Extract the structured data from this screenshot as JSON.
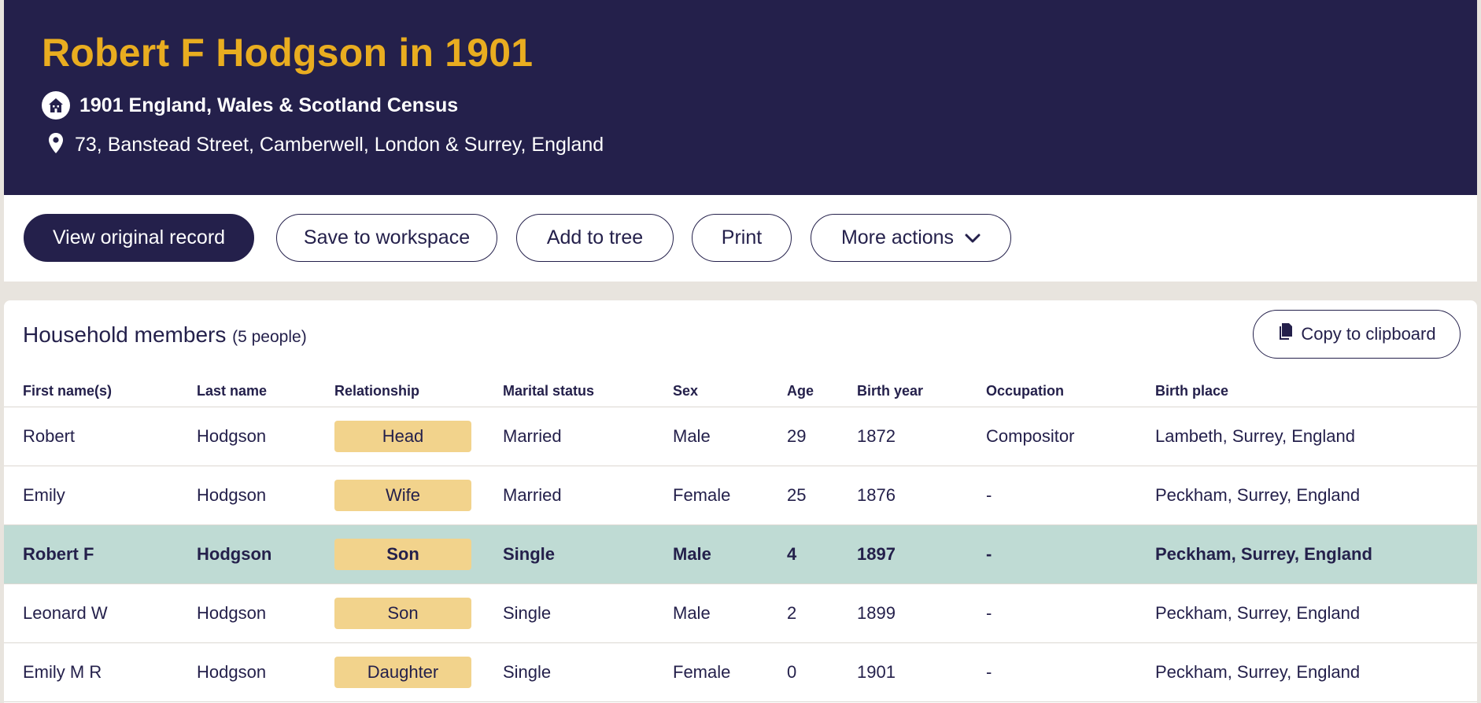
{
  "header": {
    "title": "Robert F Hodgson in 1901",
    "collection": "1901 England, Wales & Scotland Census",
    "address": "73, Banstead Street, Camberwell, London & Surrey, England"
  },
  "actions": {
    "view_original": "View original record",
    "save_workspace": "Save to workspace",
    "add_to_tree": "Add to tree",
    "print": "Print",
    "more_actions": "More actions"
  },
  "household": {
    "title": "Household members",
    "count": "(5 people)",
    "copy_label": "Copy to clipboard",
    "columns": [
      "First name(s)",
      "Last name",
      "Relationship",
      "Marital status",
      "Sex",
      "Age",
      "Birth year",
      "Occupation",
      "Birth place"
    ],
    "rows": [
      [
        "Robert",
        "Hodgson",
        "Head",
        "Married",
        "Male",
        "29",
        "1872",
        "Compositor",
        "Lambeth, Surrey, England"
      ],
      [
        "Emily",
        "Hodgson",
        "Wife",
        "Married",
        "Female",
        "25",
        "1876",
        "-",
        "Peckham, Surrey, England"
      ],
      [
        "Robert F",
        "Hodgson",
        "Son",
        "Single",
        "Male",
        "4",
        "1897",
        "-",
        "Peckham, Surrey, England"
      ],
      [
        "Leonard W",
        "Hodgson",
        "Son",
        "Single",
        "Male",
        "2",
        "1899",
        "-",
        "Peckham, Surrey, England"
      ],
      [
        "Emily M R",
        "Hodgson",
        "Daughter",
        "Single",
        "Female",
        "0",
        "1901",
        "-",
        "Peckham, Surrey, England"
      ]
    ]
  },
  "colors": {
    "navy": "#24204b",
    "gold": "#e9ad20",
    "highlight_row": "#bfdbd4",
    "badge": "#f2d38c"
  }
}
